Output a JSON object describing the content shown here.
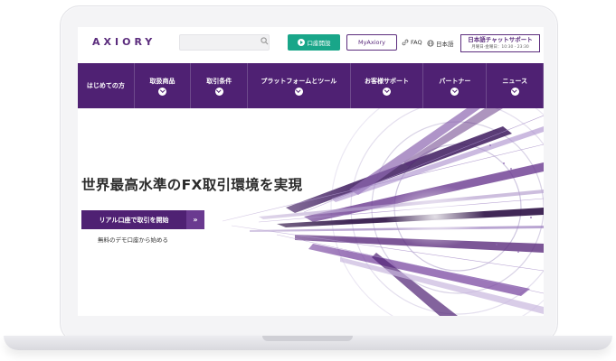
{
  "header": {
    "logo": "AXIORY",
    "search_placeholder": "",
    "open_account_label": "口座開設",
    "myaxiory_label": "MyAxiory",
    "faq_label": "FAQ",
    "language_label": "日本語",
    "support_title": "日本語チャットサポート",
    "support_hours": "月曜日-金曜日：10:30 - 23:30"
  },
  "nav": {
    "items": [
      {
        "label": "はじめての方"
      },
      {
        "label": "取扱商品"
      },
      {
        "label": "取引条件"
      },
      {
        "label": "プラットフォームとツール"
      },
      {
        "label": "お客様サポート"
      },
      {
        "label": "パートナー"
      },
      {
        "label": "ニュース"
      }
    ]
  },
  "hero": {
    "title": "世界最高水準のFX取引環境を実現",
    "cta_label": "リアル口座で取引を開始",
    "cta_arrow": "»",
    "demo_link": "無料のデモ口座から始める"
  },
  "colors": {
    "brand": "#4f2173",
    "accent_green": "#19a689"
  }
}
